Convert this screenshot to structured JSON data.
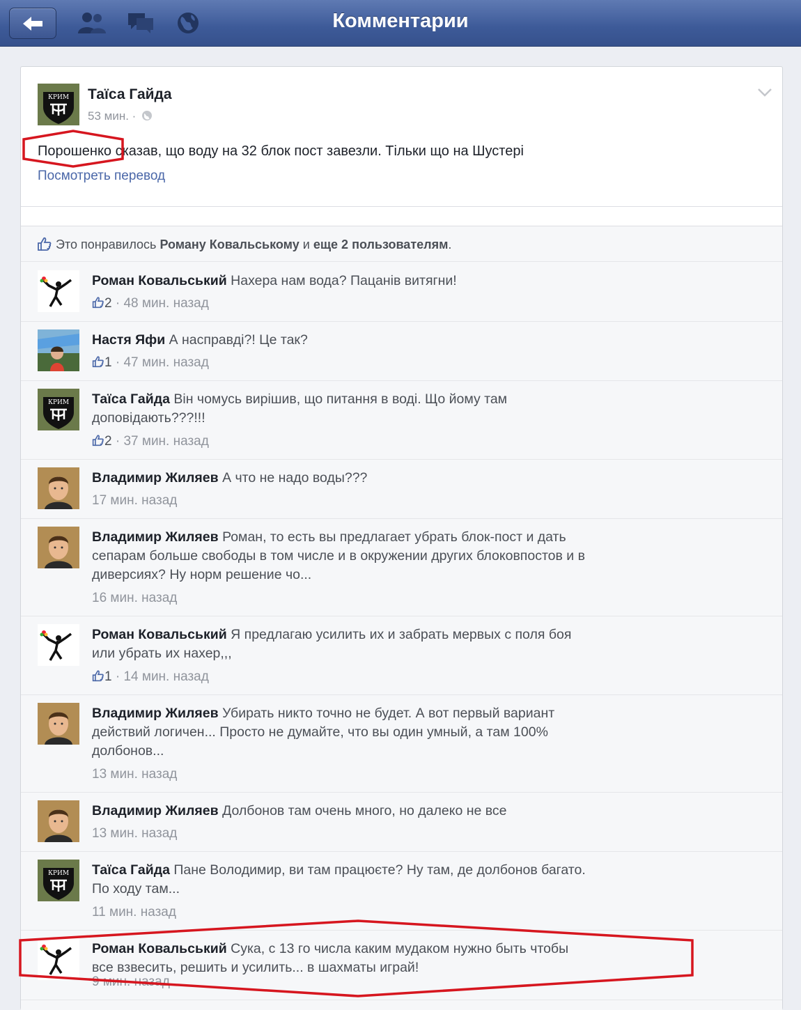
{
  "header": {
    "title": "Комментарии"
  },
  "post": {
    "author": "Таїса Гайда",
    "time": "53 мин. ·",
    "text": "Порошенко сказав, що воду на 32 блок пост завезли. Тільки що на Шустері",
    "translate_label": "Посмотреть перевод"
  },
  "likes": {
    "prefix": "Это понравилось",
    "user": "Роману Ковальському",
    "middle": "и",
    "others": "еще 2 пользователям",
    "suffix": "."
  },
  "comments": [
    {
      "author": "Роман Ковальський",
      "text": "Нахера нам вода? Пацанів витягни!",
      "likes": "2",
      "time": "48 мин. назад",
      "avatar": "banksy"
    },
    {
      "author": "Настя Яфи",
      "text": "А насправді?! Це так?",
      "likes": "1",
      "time": "47 мин. назад",
      "avatar": "photo-flag"
    },
    {
      "author": "Таїса Гайда",
      "text": "Він чомусь вирішив, що питання в воді. Що йому там доповідають???!!!",
      "likes": "2",
      "time": "37 мин. назад",
      "avatar": "crimea-emblem"
    },
    {
      "author": "Владимир Жиляев",
      "text": "А что не надо воды???",
      "likes": "",
      "time": "17 мин. назад",
      "avatar": "photo-man"
    },
    {
      "author": "Владимир Жиляев",
      "text": "Роман, то есть вы предлагает убрать блок-пост и дать сепарам больше свободы в том числе и в окружении других блоковпостов и в диверсиях? Ну норм решение чо...",
      "likes": "",
      "time": "16 мин. назад",
      "avatar": "photo-man"
    },
    {
      "author": "Роман Ковальський",
      "text": "Я предлагаю усилить их и забрать мервых с поля боя или убрать их нахер,,,",
      "likes": "1",
      "time": "14 мин. назад",
      "avatar": "banksy"
    },
    {
      "author": "Владимир Жиляев",
      "text": "Убирать никто точно не будет. А вот первый вариант действий логичен... Просто не думайте, что вы один умный, а там 100% долбонов...",
      "likes": "",
      "time": "13 мин. назад",
      "avatar": "photo-man"
    },
    {
      "author": "Владимир Жиляев",
      "text": "Долбонов там очень много, но далеко не все",
      "likes": "",
      "time": "13 мин. назад",
      "avatar": "photo-man"
    },
    {
      "author": "Таїса Гайда",
      "text": "Пане Володимир, ви там працюєте? Ну там, де долбонов багато. По ходу там...",
      "likes": "",
      "time": "11 мин. назад",
      "avatar": "crimea-emblem"
    },
    {
      "author": "Роман Ковальський",
      "text": "Сука, с 13 го числа каким мудаком нужно быть чтобы все взвесить, решить и усилить... в шахматы играй!",
      "likes": "",
      "time": "9 мин. назад",
      "avatar": "banksy"
    }
  ],
  "avatar_label": "КРИМ",
  "icons": {
    "back": "back-arrow-icon",
    "friends": "friends-icon",
    "messages": "messages-icon",
    "globe": "globe-icon",
    "like": "thumbs-up-icon"
  },
  "colors": {
    "brand": "#3d5a98",
    "link": "#4a67a8",
    "annotation": "#d6161f"
  }
}
